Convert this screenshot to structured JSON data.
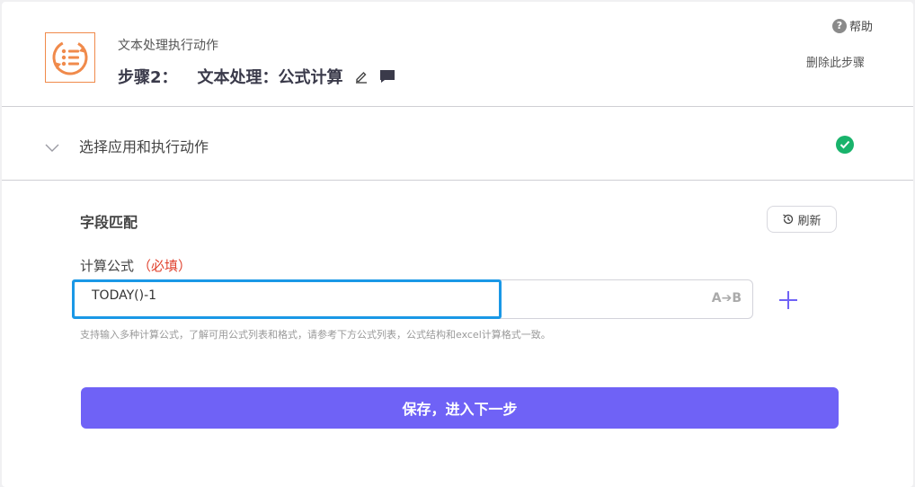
{
  "header": {
    "subtitle": "文本处理执行动作",
    "step_label": "步骤2：",
    "step_title": "文本处理：公式计算",
    "help_label": "帮助",
    "delete_label": "删除此步骤"
  },
  "section_app": {
    "title": "选择应用和执行动作",
    "status": "completed"
  },
  "field_mapping": {
    "title": "字段匹配",
    "refresh_label": "刷新",
    "fields": [
      {
        "label": "计算公式",
        "required_tag": "（必填）",
        "value": "TODAY()-1",
        "type_badge": "A➔B",
        "hint": "支持输入多种计算公式，了解可用公式列表和格式，请参考下方公式列表，公式结构和excel计算格式一致。"
      }
    ]
  },
  "save_button_label": "保存，进入下一步",
  "colors": {
    "accent": "#6f62f6",
    "app_icon": "#f08a4b",
    "success": "#19b36b",
    "required": "#e0432f",
    "focus_border": "#1a98e6"
  },
  "icons": [
    "app-text-processing-icon",
    "edit-icon",
    "comment-icon",
    "help-icon",
    "chevron-down-icon",
    "check-circle-icon",
    "refresh-icon",
    "type-transform-icon",
    "plus-icon"
  ]
}
